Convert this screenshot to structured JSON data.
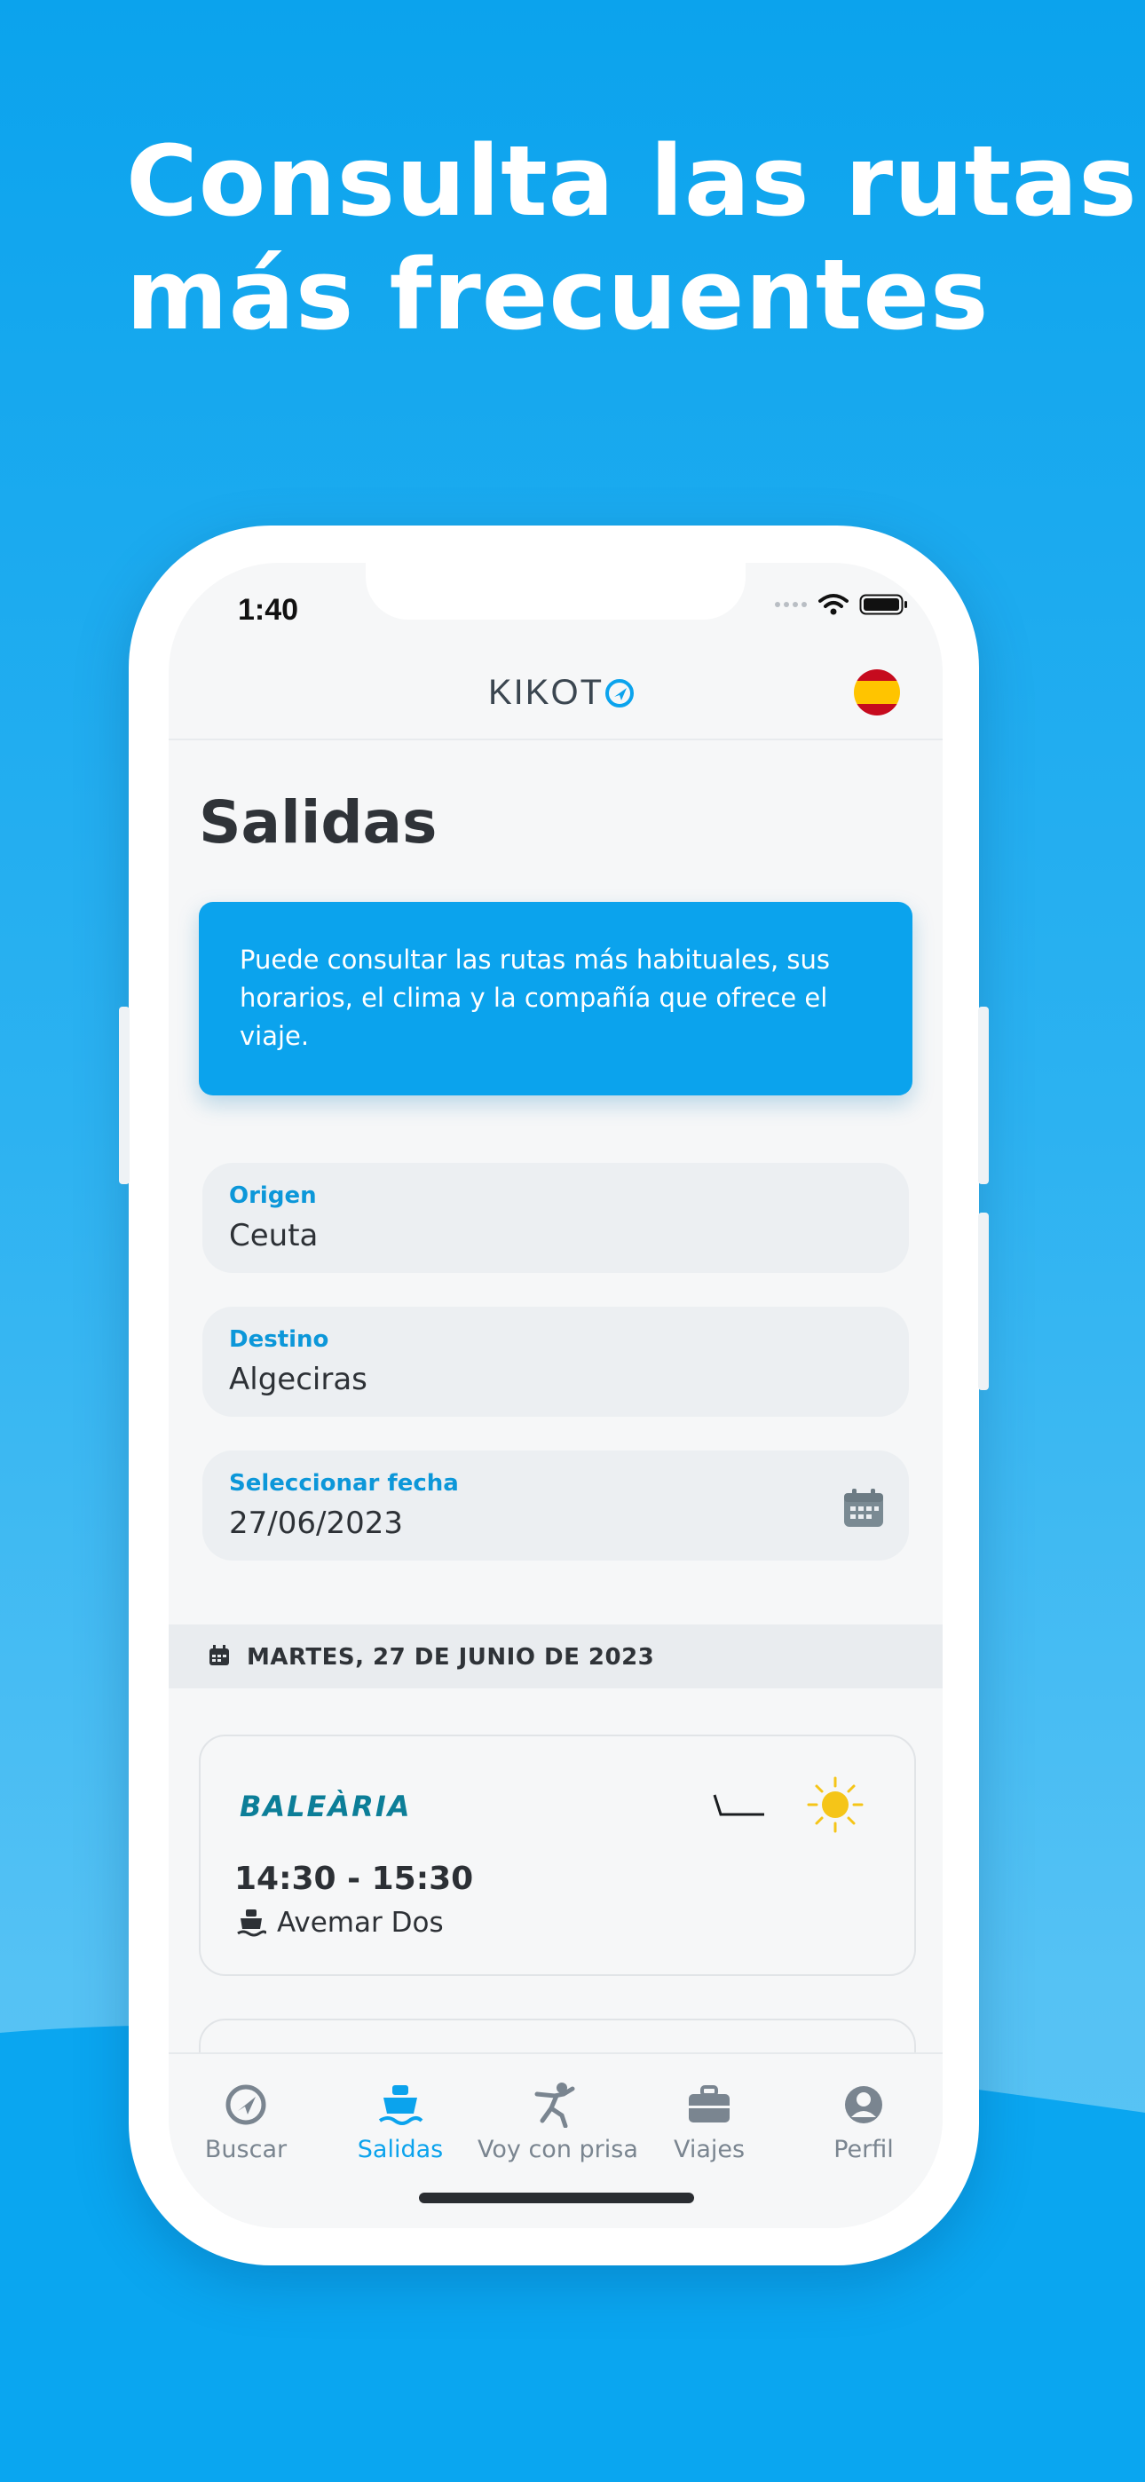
{
  "headline": {
    "line1": "Consulta las rutas",
    "line2": "más frecuentes"
  },
  "status_bar": {
    "time": "1:40"
  },
  "app": {
    "logo": "KIKOT"
  },
  "page": {
    "title": "Salidas",
    "info": "Puede consultar las rutas más habituales, sus horarios, el clima y la compañía que ofrece el viaje."
  },
  "form": {
    "origin": {
      "label": "Origen",
      "value": "Ceuta"
    },
    "destination": {
      "label": "Destino",
      "value": "Algeciras"
    },
    "date": {
      "label": "Seleccionar fecha",
      "value": "27/06/2023"
    }
  },
  "date_header": "MARTES, 27 DE JUNIO DE 2023",
  "routes": [
    {
      "company": "BALEÀRIA",
      "time": "14:30 - 15:30",
      "ship": "Avemar Dos",
      "weather": "sun-icon"
    }
  ],
  "tabs": [
    {
      "label": "Buscar",
      "icon": "compass-icon"
    },
    {
      "label": "Salidas",
      "icon": "ship-icon",
      "active": true
    },
    {
      "label": "Voy con prisa",
      "icon": "running-icon"
    },
    {
      "label": "Viajes",
      "icon": "briefcase-icon"
    },
    {
      "label": "Perfil",
      "icon": "user-icon"
    }
  ],
  "colors": {
    "brand_blue": "#0ba3ed",
    "label_blue": "#0c97d9",
    "company_teal": "#0c7e98"
  }
}
